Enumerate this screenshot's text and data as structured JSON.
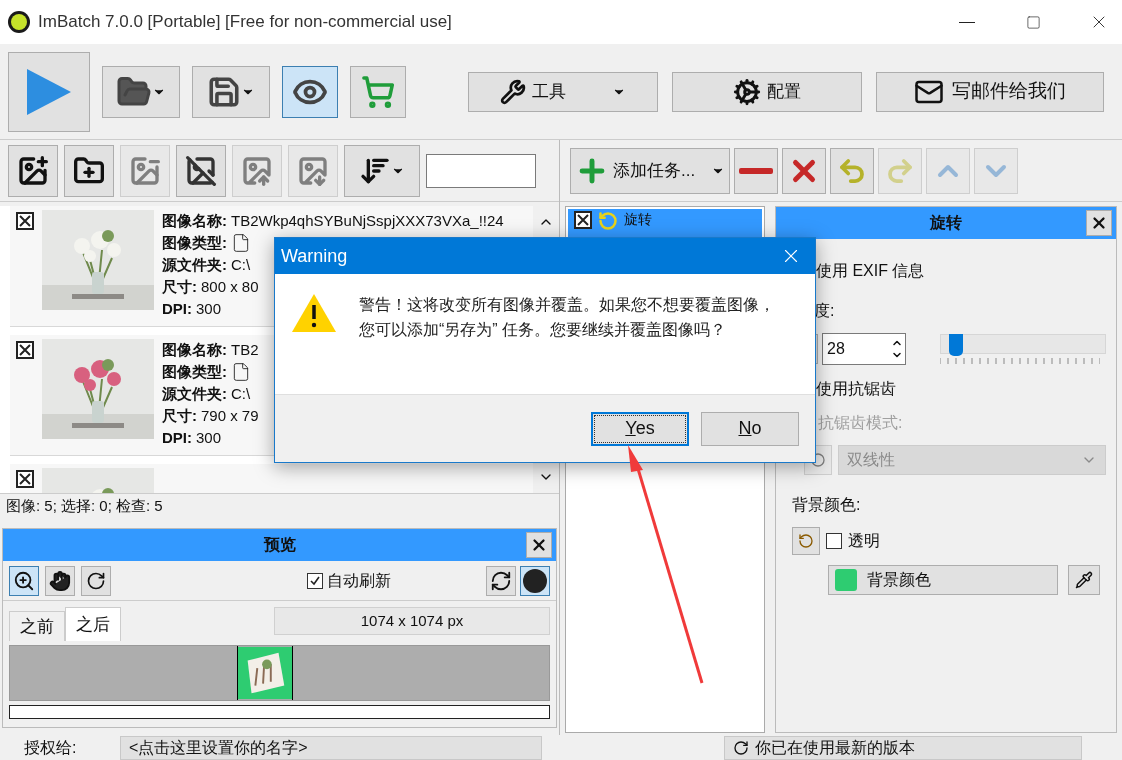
{
  "window": {
    "title": "ImBatch 7.0.0 [Portable] [Free for non-commercial use]"
  },
  "main_toolbar": {
    "preview_on": true,
    "tools": "工具",
    "settings": "配置",
    "email": "写邮件给我们"
  },
  "images": [
    {
      "checked": true,
      "fields": [
        {
          "label": "图像名称:",
          "value": "TB2Wkp4qhSYBuNjSspjXXX73VXa_!!24"
        },
        {
          "label": "图像类型:",
          "kind": "file"
        },
        {
          "label": "源文件夹:",
          "value": "C:\\"
        },
        {
          "label": "尺寸:",
          "value": "800 x 80"
        },
        {
          "label": "DPI:",
          "value": "300"
        }
      ]
    },
    {
      "checked": true,
      "fields": [
        {
          "label": "图像名称:",
          "value": "TB2"
        },
        {
          "label": "图像类型:",
          "kind": "file"
        },
        {
          "label": "源文件夹:",
          "value": "C:\\"
        },
        {
          "label": "尺寸:",
          "value": "790 x 79"
        },
        {
          "label": "DPI:",
          "value": "300"
        }
      ]
    },
    {
      "checked": true
    }
  ],
  "image_status": "图像: 5; 选择: 0; 检查: 5",
  "preview": {
    "title": "预览",
    "auto_refresh": {
      "label": "自动刷新",
      "checked": true
    },
    "tabs": [
      {
        "label": "之前",
        "selected": false
      },
      {
        "label": "之后",
        "selected": true
      }
    ],
    "size": "1074 x 1074 px",
    "progress": {
      "level": 0
    }
  },
  "task_toolbar": {
    "add": "添加任务..."
  },
  "tasks": [
    {
      "label": "旋转",
      "checked": true,
      "selected": true
    }
  ],
  "properties": {
    "title": "旋转",
    "use_exif": "使用 EXIF 信息",
    "angle_label": "度:",
    "angle_value": "28",
    "angle_slider": {
      "level": 0.05
    },
    "antialias": "使用抗锯齿",
    "mode_label": "抗锯齿模式:",
    "mode_value": "双线性",
    "mode_disabled": true,
    "bg_label": "背景颜色:",
    "transparent": {
      "label": "透明",
      "checked": false
    },
    "bg_button": {
      "label": "背景颜色",
      "color": "#2ecc71"
    }
  },
  "footer": {
    "license_label": "授权给:",
    "name_field": "<点击这里设置你的名字>",
    "update_status": "你已在使用最新的版本"
  },
  "dialog": {
    "title": "Warning",
    "message": "警告！这将改变所有图像并覆盖。如果您不想要覆盖图像，您可以添加“另存为” 任务。您要继续并覆盖图像吗？",
    "buttons": [
      {
        "label": "Yes",
        "selected": true
      },
      {
        "label": "No",
        "selected": false
      }
    ]
  }
}
